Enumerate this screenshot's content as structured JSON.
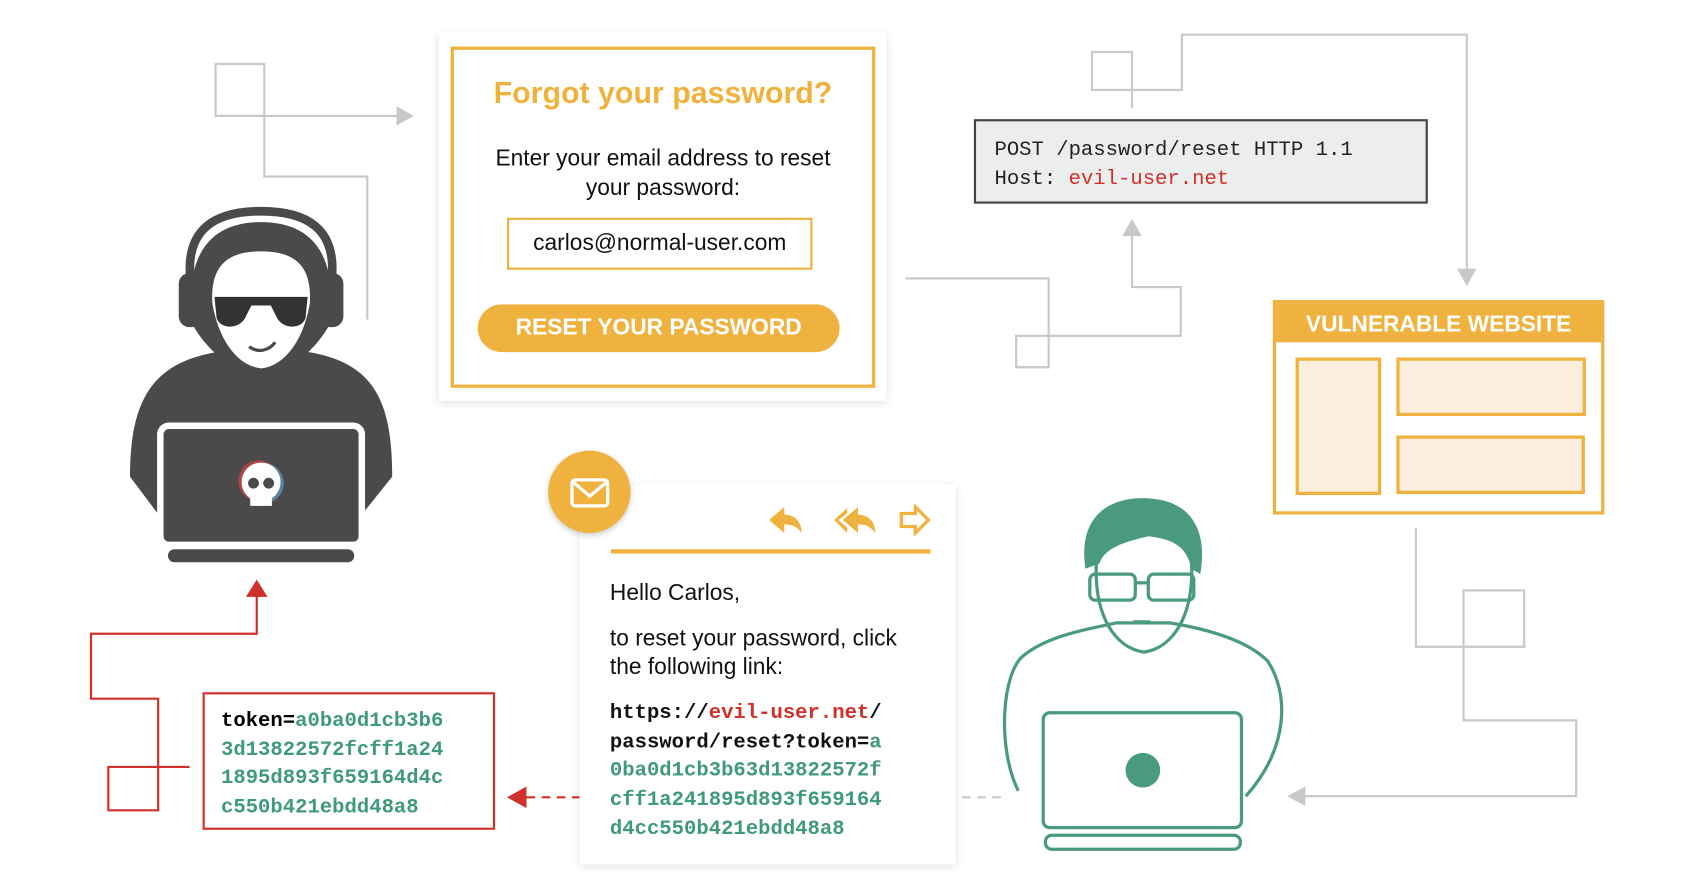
{
  "colors": {
    "accent": "#f0b23e",
    "attack": "#d0302a",
    "token": "#3f9a78",
    "connector": "#c8c8c8",
    "hacker": "#4a4a4a"
  },
  "form": {
    "title": "Forgot your password?",
    "description_line1": "Enter your email address to reset",
    "description_line2": "your password:",
    "email_value": "carlos@normal-user.com",
    "button_label": "RESET YOUR PASSWORD"
  },
  "request": {
    "line1": "POST /password/reset HTTP 1.1",
    "host_label": "Host: ",
    "host_value": "evil-user.net"
  },
  "website": {
    "label": "VULNERABLE WEBSITE"
  },
  "email": {
    "icon": "envelope-icon",
    "actions": [
      "reply-icon",
      "reply-all-icon",
      "forward-icon"
    ],
    "greeting": "Hello Carlos,",
    "body_line1": "to reset your password, click",
    "body_line2": "the following link:",
    "link_prefix": "https://",
    "link_domain": "evil-user.net",
    "link_slash": "/",
    "link_path": "password/reset?token=",
    "token_first": "a",
    "token_lines": [
      "0ba0d1cb3b63d13822572f",
      "cff1a241895d893f659164",
      "d4cc550b421ebdd48a8"
    ]
  },
  "stolen_token": {
    "label": "token=",
    "lines": [
      "a0ba0d1cb3b6",
      "3d13822572fcff1a24",
      "1895d893f659164d4c",
      "c550b421ebdd48a8"
    ]
  }
}
